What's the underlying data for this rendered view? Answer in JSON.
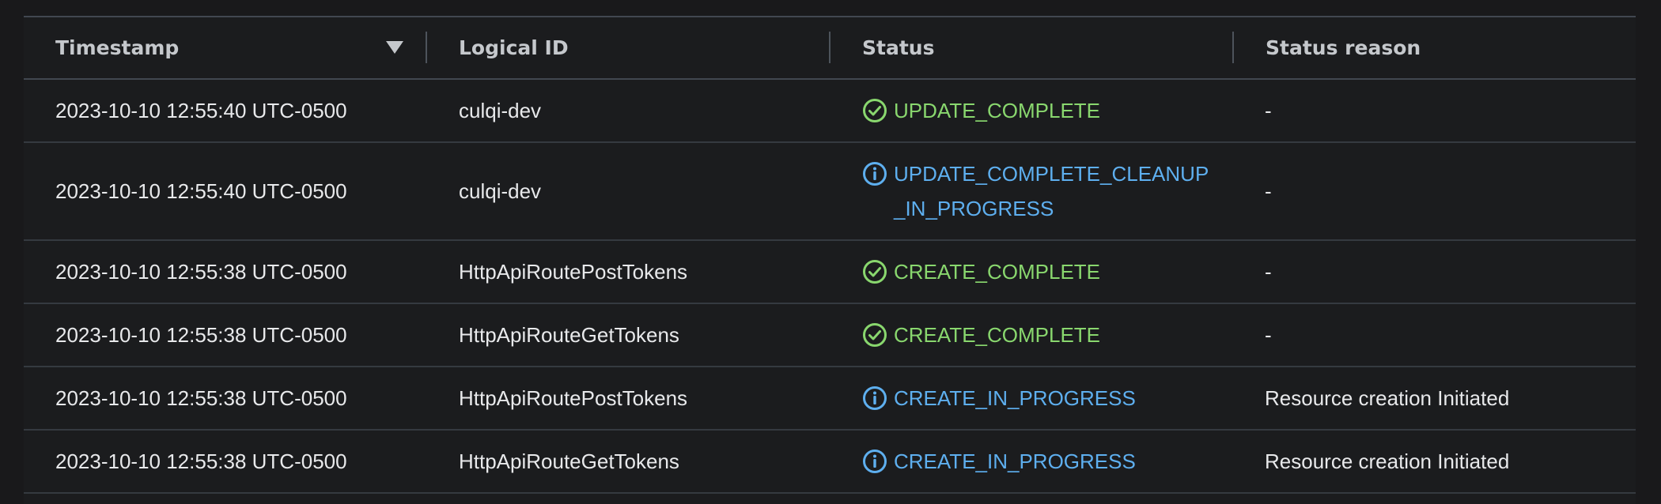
{
  "colors": {
    "success": "#89d76e",
    "info": "#5eafef",
    "text": "#e8e9eb",
    "header_text": "#c5c8cc",
    "background": "#1b1c1e"
  },
  "table": {
    "headers": {
      "timestamp": "Timestamp",
      "logical_id": "Logical ID",
      "status": "Status",
      "status_reason": "Status reason"
    },
    "sort": {
      "column": "timestamp",
      "direction": "descending",
      "icon": "sort-descending-icon"
    },
    "rows": [
      {
        "timestamp": "2023-10-10 12:55:40 UTC-0500",
        "logical_id": "culqi-dev",
        "status": "UPDATE_COMPLETE",
        "status_icon": "check-circle-icon",
        "status_reason": "-"
      },
      {
        "timestamp": "2023-10-10 12:55:40 UTC-0500",
        "logical_id": "culqi-dev",
        "status": "UPDATE_COMPLETE_CLEANUP_IN_PROGRESS",
        "status_icon": "info-circle-icon",
        "status_reason": "-"
      },
      {
        "timestamp": "2023-10-10 12:55:38 UTC-0500",
        "logical_id": "HttpApiRoutePostTokens",
        "status": "CREATE_COMPLETE",
        "status_icon": "check-circle-icon",
        "status_reason": "-"
      },
      {
        "timestamp": "2023-10-10 12:55:38 UTC-0500",
        "logical_id": "HttpApiRouteGetTokens",
        "status": "CREATE_COMPLETE",
        "status_icon": "check-circle-icon",
        "status_reason": "-"
      },
      {
        "timestamp": "2023-10-10 12:55:38 UTC-0500",
        "logical_id": "HttpApiRoutePostTokens",
        "status": "CREATE_IN_PROGRESS",
        "status_icon": "info-circle-icon",
        "status_reason": "Resource creation Initiated"
      },
      {
        "timestamp": "2023-10-10 12:55:38 UTC-0500",
        "logical_id": "HttpApiRouteGetTokens",
        "status": "CREATE_IN_PROGRESS",
        "status_icon": "info-circle-icon",
        "status_reason": "Resource creation Initiated"
      }
    ]
  }
}
